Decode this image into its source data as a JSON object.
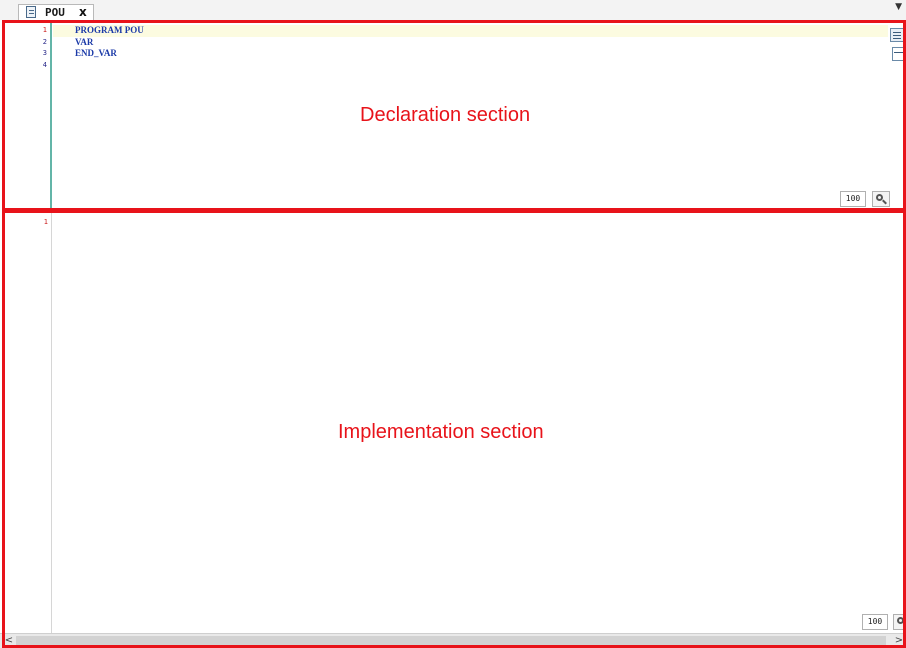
{
  "tab": {
    "title": "POU",
    "close_glyph": "x",
    "dropdown_glyph": "▼"
  },
  "declaration": {
    "line_numbers": [
      "1",
      "2",
      "3",
      "4"
    ],
    "code_lines": [
      "PROGRAM POU",
      "VAR",
      "END_VAR",
      ""
    ],
    "zoom": "100",
    "label": "Declaration section"
  },
  "implementation": {
    "line_numbers": [
      "1"
    ],
    "zoom": "100",
    "label": "Implementation section"
  },
  "scrollbar": {
    "left_arrow": "<",
    "right_arrow": ">"
  },
  "colors": {
    "annotation": "#e8131a",
    "keyword": "#1b3aa8",
    "current_line": "#fcfbe0",
    "gutter_accent": "#63b5a8"
  },
  "icons": [
    "document-icon",
    "close-icon",
    "chevron-down-icon",
    "zoom-icon",
    "text-view-icon",
    "table-view-icon"
  ]
}
